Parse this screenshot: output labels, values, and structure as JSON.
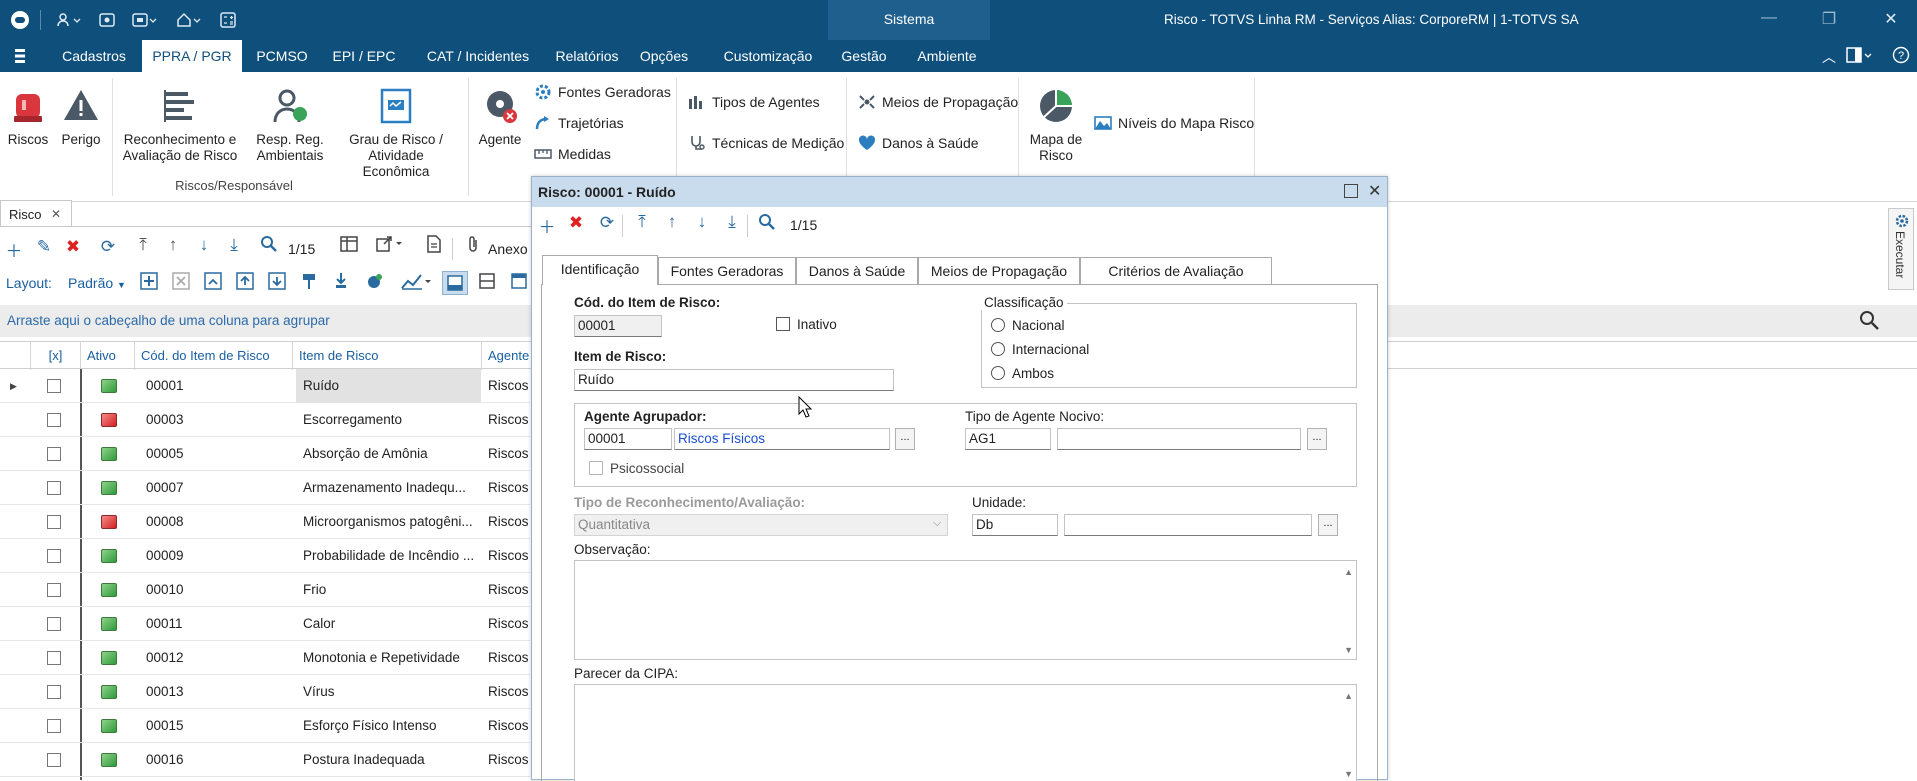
{
  "colors": {
    "brand": "#0e4f7c",
    "menu_active_text": "#0e4f7c",
    "link_blue": "#1a5fa0",
    "dialog_title_bg": "#c9dcee"
  },
  "titlebar": {
    "sistema": "Sistema",
    "window_title": "Risco - TOTVS Linha RM - Serviços  Alias: CorporeRM | 1-TOTVS SA"
  },
  "menu": {
    "items": [
      "Cadastros",
      "PPRA / PGR",
      "PCMSO",
      "EPI / EPC",
      "CAT / Incidentes",
      "Relatórios",
      "Opções",
      "Customização",
      "Gestão",
      "Ambiente"
    ],
    "active": "PPRA / PGR"
  },
  "ribbon": {
    "riscos": "Riscos",
    "perigo": "Perigo",
    "reconhecimento_1": "Reconhecimento e",
    "reconhecimento_2": "Avaliação de Risco",
    "resp_1": "Resp. Reg.",
    "resp_2": "Ambientais",
    "grau_1": "Grau de Risco /",
    "grau_2": "Atividade Econômica",
    "group_label": "Riscos/Responsável",
    "agente": "Agente",
    "fontes_geradoras": "Fontes Geradoras",
    "trajetorias": "Trajetórias",
    "medidas": "Medidas",
    "tipos_de_agentes": "Tipos de Agentes",
    "tecnicas_de_medicao": "Técnicas de Medição",
    "meios_de_propagacao": "Meios de Propagação",
    "danos_a_saude": "Danos à Saúde",
    "mapa_1": "Mapa de",
    "mapa_2": "Risco",
    "niveis_mapa": "Níveis do Mapa Risco"
  },
  "doc_tab": {
    "label": "Risco",
    "close": "✕"
  },
  "list_toolbar": {
    "counter": "1/15",
    "anexo": "Anexo",
    "layout_label": "Layout:",
    "layout_value": "Padrão"
  },
  "group_hint": "Arraste aqui o cabeçalho de uma coluna para agrupar",
  "grid": {
    "columns": [
      "[x]",
      "Ativo",
      "Cód. do Item de Risco",
      "Item de Risco",
      "Agente"
    ],
    "rows": [
      {
        "code": "00001",
        "item": "Ruído",
        "agente": "Riscos",
        "ativo": true,
        "selected": true
      },
      {
        "code": "00003",
        "item": "Escorregamento",
        "agente": "Riscos",
        "ativo": false
      },
      {
        "code": "00005",
        "item": "Absorção de Amônia",
        "agente": "Riscos",
        "ativo": true
      },
      {
        "code": "00007",
        "item": "Armazenamento Inadequ...",
        "agente": "Riscos",
        "ativo": true
      },
      {
        "code": "00008",
        "item": "Microorganismos patogêni...",
        "agente": "Riscos",
        "ativo": false
      },
      {
        "code": "00009",
        "item": "Probabilidade de Incêndio ...",
        "agente": "Riscos",
        "ativo": true
      },
      {
        "code": "00010",
        "item": "Frio",
        "agente": "Riscos",
        "ativo": true
      },
      {
        "code": "00011",
        "item": "Calor",
        "agente": "Riscos",
        "ativo": true
      },
      {
        "code": "00012",
        "item": "Monotonia e Repetividade",
        "agente": "Riscos",
        "ativo": true
      },
      {
        "code": "00013",
        "item": "Vírus",
        "agente": "Riscos",
        "ativo": true
      },
      {
        "code": "00015",
        "item": "Esforço Físico Intenso",
        "agente": "Riscos",
        "ativo": true
      },
      {
        "code": "00016",
        "item": "Postura Inadequada",
        "agente": "Riscos",
        "ativo": true
      }
    ]
  },
  "dialog": {
    "title": "Risco: 00001 - Ruído",
    "counter": "1/15",
    "tabs": [
      "Identificação",
      "Fontes Geradoras",
      "Danos à Saúde",
      "Meios de Propagação",
      "Critérios de Avaliação"
    ],
    "active_tab": "Identificação",
    "cod_label": "Cód. do Item de Risco:",
    "cod_value": "00001",
    "inativo_label": "Inativo",
    "classificacao_label": "Classificação",
    "radio_nacional": "Nacional",
    "radio_internacional": "Internacional",
    "radio_ambos": "Ambos",
    "item_label": "Item de Risco:",
    "item_value": "Ruído",
    "agente_label": "Agente Agrupador:",
    "agente_code": "00001",
    "agente_name": "Riscos Físicos",
    "tipo_agente_label": "Tipo de Agente Nocivo:",
    "tipo_agente_code": "AG1",
    "tipo_agente_name": "",
    "psicossocial_label": "Psicossocial",
    "tipo_reconhecimento_label": "Tipo de Reconhecimento/Avaliação:",
    "tipo_reconhecimento_value": "Quantitativa",
    "unidade_label": "Unidade:",
    "unidade_code": "Db",
    "unidade_name": "",
    "observacao_label": "Observação:",
    "parecer_label": "Parecer da CIPA:",
    "dots": "..."
  },
  "side_panel": {
    "executar": "Executar"
  }
}
